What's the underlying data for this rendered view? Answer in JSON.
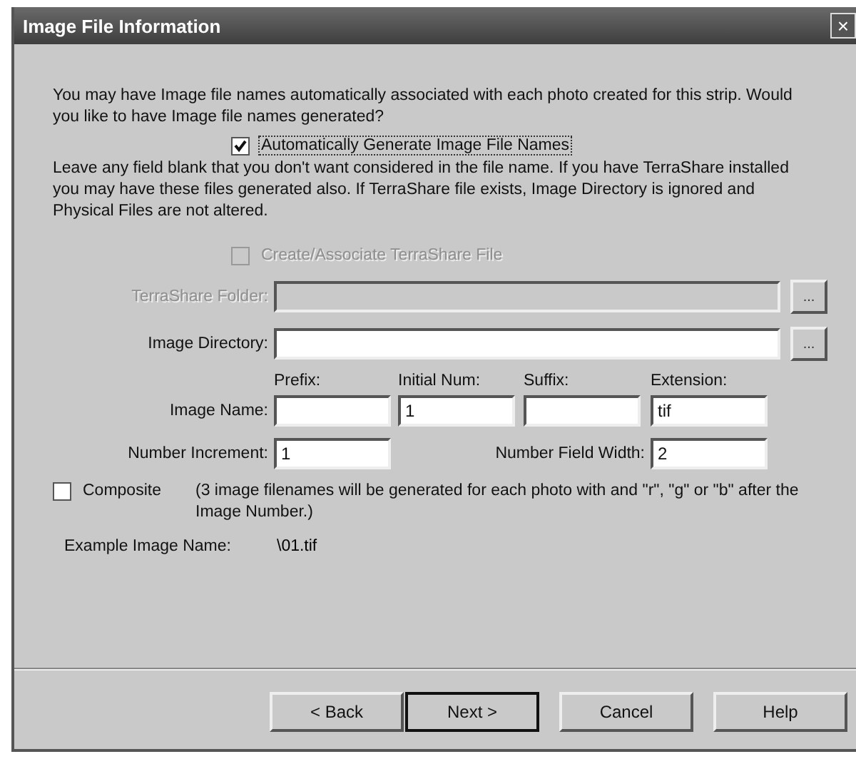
{
  "window": {
    "title": "Image File Information",
    "close": "×"
  },
  "intro": "You may have Image file names automatically associated with each photo created for this strip.  Would you like to have Image file names generated?",
  "auto_generate": {
    "label": "Automatically Generate Image File Names",
    "checked": true,
    "disabled": false
  },
  "note": "Leave any field blank that you don't want considered in the file name.  If you have TerraShare installed you may have these files generated also.  If TerraShare file exists, Image Directory is ignored and Physical Files are not altered.",
  "terrashare_file": {
    "label": "Create/Associate TerraShare File",
    "checked": false,
    "disabled": true
  },
  "terrashare_folder": {
    "label": "TerraShare Folder:",
    "disabled": true,
    "browse": "..."
  },
  "image_directory": {
    "label": "Image Directory:",
    "disabled": false,
    "browse": "..."
  },
  "image_name": {
    "label": "Image Name:",
    "parts": [
      {
        "header": "Prefix:"
      },
      {
        "header": "Initial Num:",
        "value": "1"
      },
      {
        "header": "Suffix:"
      },
      {
        "header": "Extension:",
        "value": "tif"
      }
    ]
  },
  "number_increment": {
    "label": "Number Increment:",
    "value": "1"
  },
  "number_field_width": {
    "label": "Number Field Width:",
    "value": "2"
  },
  "composite": {
    "label": "Composite",
    "checked": false,
    "disabled": false,
    "note": "(3 image filenames will be generated for each photo with and \"r\", \"g\" or \"b\" after the Image Number.)"
  },
  "example": {
    "label": "Example Image Name:",
    "value": "\\01.tif"
  },
  "buttons": [
    {
      "label": "< Back",
      "default": false
    },
    {
      "label": "Next >",
      "default": true
    },
    {
      "label": "Cancel",
      "default": false
    },
    {
      "label": "Help",
      "default": false
    }
  ]
}
